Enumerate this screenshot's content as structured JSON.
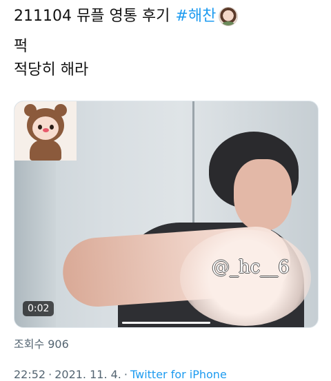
{
  "tweet": {
    "title": "211104 뮤플 영통 후기",
    "hashtag": "#해찬",
    "line2": "퍽",
    "line3": "적당히 해라",
    "media": {
      "watermark": "@_hc__6",
      "duration": "0:02",
      "progress": 1.0
    },
    "views": "조회수 906",
    "time": "22:52",
    "date": "2021. 11. 4.",
    "source": "Twitter for iPhone",
    "separator": "·"
  },
  "colors": {
    "link": "#1d9bf0",
    "secondary_text": "#536471"
  },
  "icons": [
    "avatar-emoji-icon"
  ]
}
